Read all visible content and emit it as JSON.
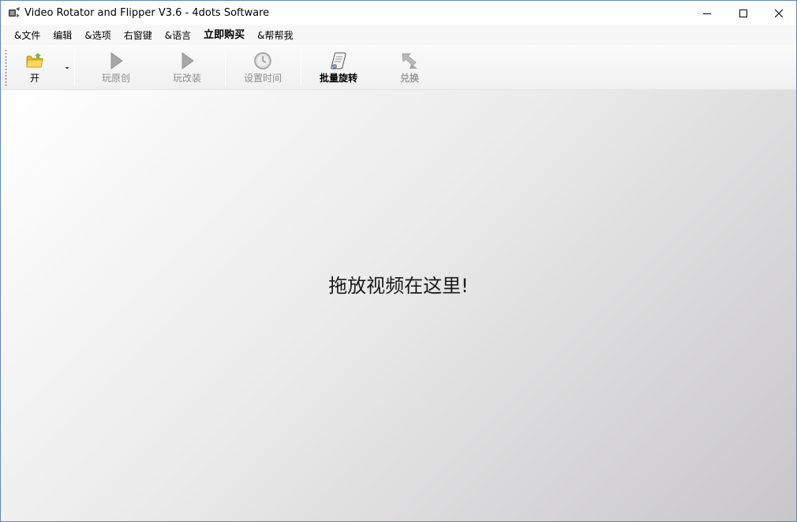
{
  "window": {
    "title": "Video Rotator and Flipper V3.6 - 4dots Software"
  },
  "menu": {
    "items": [
      {
        "label": "&文件",
        "bold": false
      },
      {
        "label": "编辑",
        "bold": false
      },
      {
        "label": "&选项",
        "bold": false
      },
      {
        "label": "右窗键",
        "bold": false
      },
      {
        "label": "&语言",
        "bold": false
      },
      {
        "label": "立即购买",
        "bold": true
      },
      {
        "label": "&帮帮我",
        "bold": false
      }
    ]
  },
  "toolbar": {
    "open_label": "开",
    "play_original_label": "玩原创",
    "play_modified_label": "玩改装",
    "set_time_label": "设置时间",
    "batch_rotate_label": "批量旋转",
    "convert_label": "兑换"
  },
  "droparea": {
    "prompt": "拖放视频在这里!"
  },
  "icons": {
    "open": "folder-icon",
    "play_original": "play-icon",
    "play_modified": "play-icon",
    "set_time": "clock-icon",
    "batch_rotate": "scroll-icon",
    "convert": "convert-arrow-icon"
  }
}
